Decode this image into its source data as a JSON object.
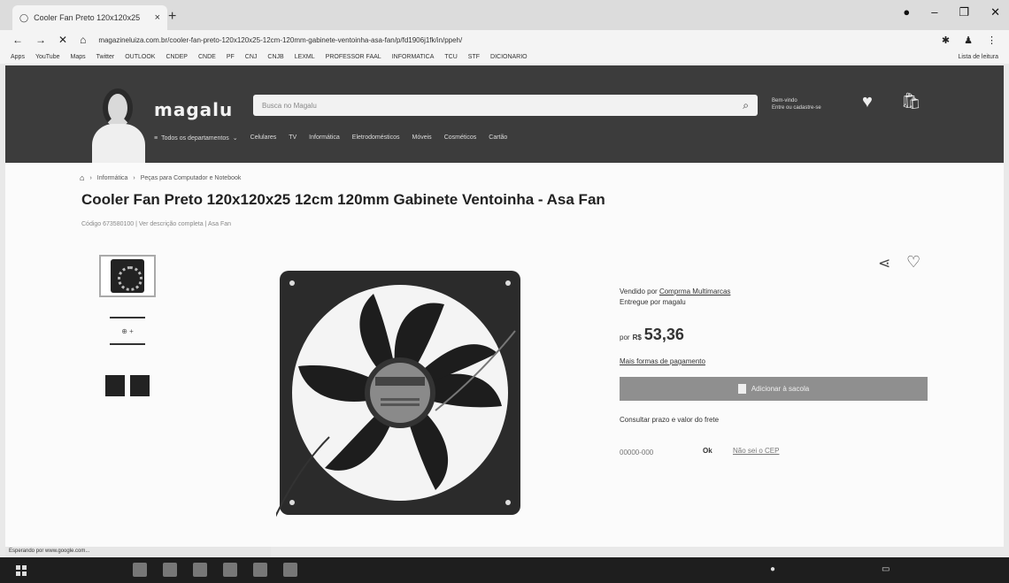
{
  "browser": {
    "tab_title": "Cooler Fan Preto 120x120x25",
    "tab_close": "×",
    "new_tab": "+",
    "window_controls": [
      "●",
      "–",
      "❐",
      "✕"
    ],
    "nav_glyphs": [
      "←",
      "→",
      "✕",
      "⌂"
    ],
    "url": "magazineluiza.com.br/cooler-fan-preto-120x120x25-12cm-120mm-gabinete-ventoinha-asa-fan/p/fd1906j1fk/in/ppeh/",
    "bookmarks": [
      "Apps",
      "YouTube",
      "Maps",
      "Twitter",
      "OUTLOOK",
      "CNDEP",
      "CNDE",
      "PF",
      "CNJ",
      "CNJB",
      "LEXML",
      "PROFESSOR FAAL",
      "INFORMATICA",
      "TCU",
      "STF",
      "DICIONARIO"
    ],
    "reading_list": "Lista de leitura"
  },
  "header": {
    "logo": "magalu",
    "search_placeholder": "Busca no Magalu",
    "account_line1": "Bem-vindo",
    "account_line2": "Entre ou cadastre-se",
    "nav": {
      "departments": "Todos os departamentos",
      "items": [
        "Celulares",
        "TV",
        "Informática",
        "Eletrodomésticos",
        "Móveis",
        "Cosméticos"
      ],
      "card": "Cartão"
    }
  },
  "product": {
    "breadcrumb": [
      "Informática",
      "Peças para Computador e Notebook"
    ],
    "title": "Cooler Fan Preto 120x120x25 12cm 120mm Gabinete Ventoinha - Asa Fan",
    "code": "Código 673580100",
    "subcodes": [
      "Ver descrição completa",
      "Asa Fan"
    ],
    "sold_by_label": "Vendido por",
    "sold_by": "Comprma Multimarcas",
    "delivered_label": "Entregue por",
    "delivered_by": "magalu",
    "price_prefix": "por",
    "currency": "R$",
    "price": "53,36",
    "more_payment": "Mais formas de pagamento",
    "add_to_bag": "Adicionar à sacola",
    "freight_label": "Consultar prazo e valor do frete",
    "cep_placeholder": "00000-000",
    "ok": "Ok",
    "no_cep": "Não sei o CEP"
  },
  "status_text": "Esperando por www.google.com...",
  "colors": {
    "header_bg": "#3c3c3c",
    "button_bg": "#8f8f8f",
    "taskbar_bg": "#1e1e1e"
  }
}
